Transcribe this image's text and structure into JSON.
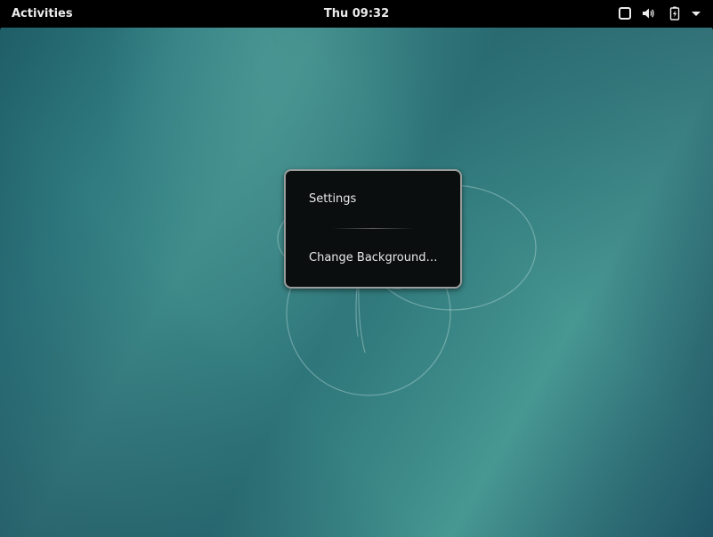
{
  "top_bar": {
    "activities_label": "Activities",
    "clock": "Thu 09:32",
    "tray": {
      "icons": [
        "window-icon",
        "volume-icon",
        "battery-icon",
        "menu-arrow-icon"
      ]
    }
  },
  "context_menu": {
    "items": [
      {
        "label": "Settings"
      },
      {
        "label": "Change Background…"
      }
    ]
  },
  "colors": {
    "top_bar_bg": "#000000",
    "menu_bg": "#0b0e0f",
    "menu_border": "#9a9d9c",
    "wallpaper_teal": "#3d8a89",
    "text": "#e8e8e8"
  }
}
